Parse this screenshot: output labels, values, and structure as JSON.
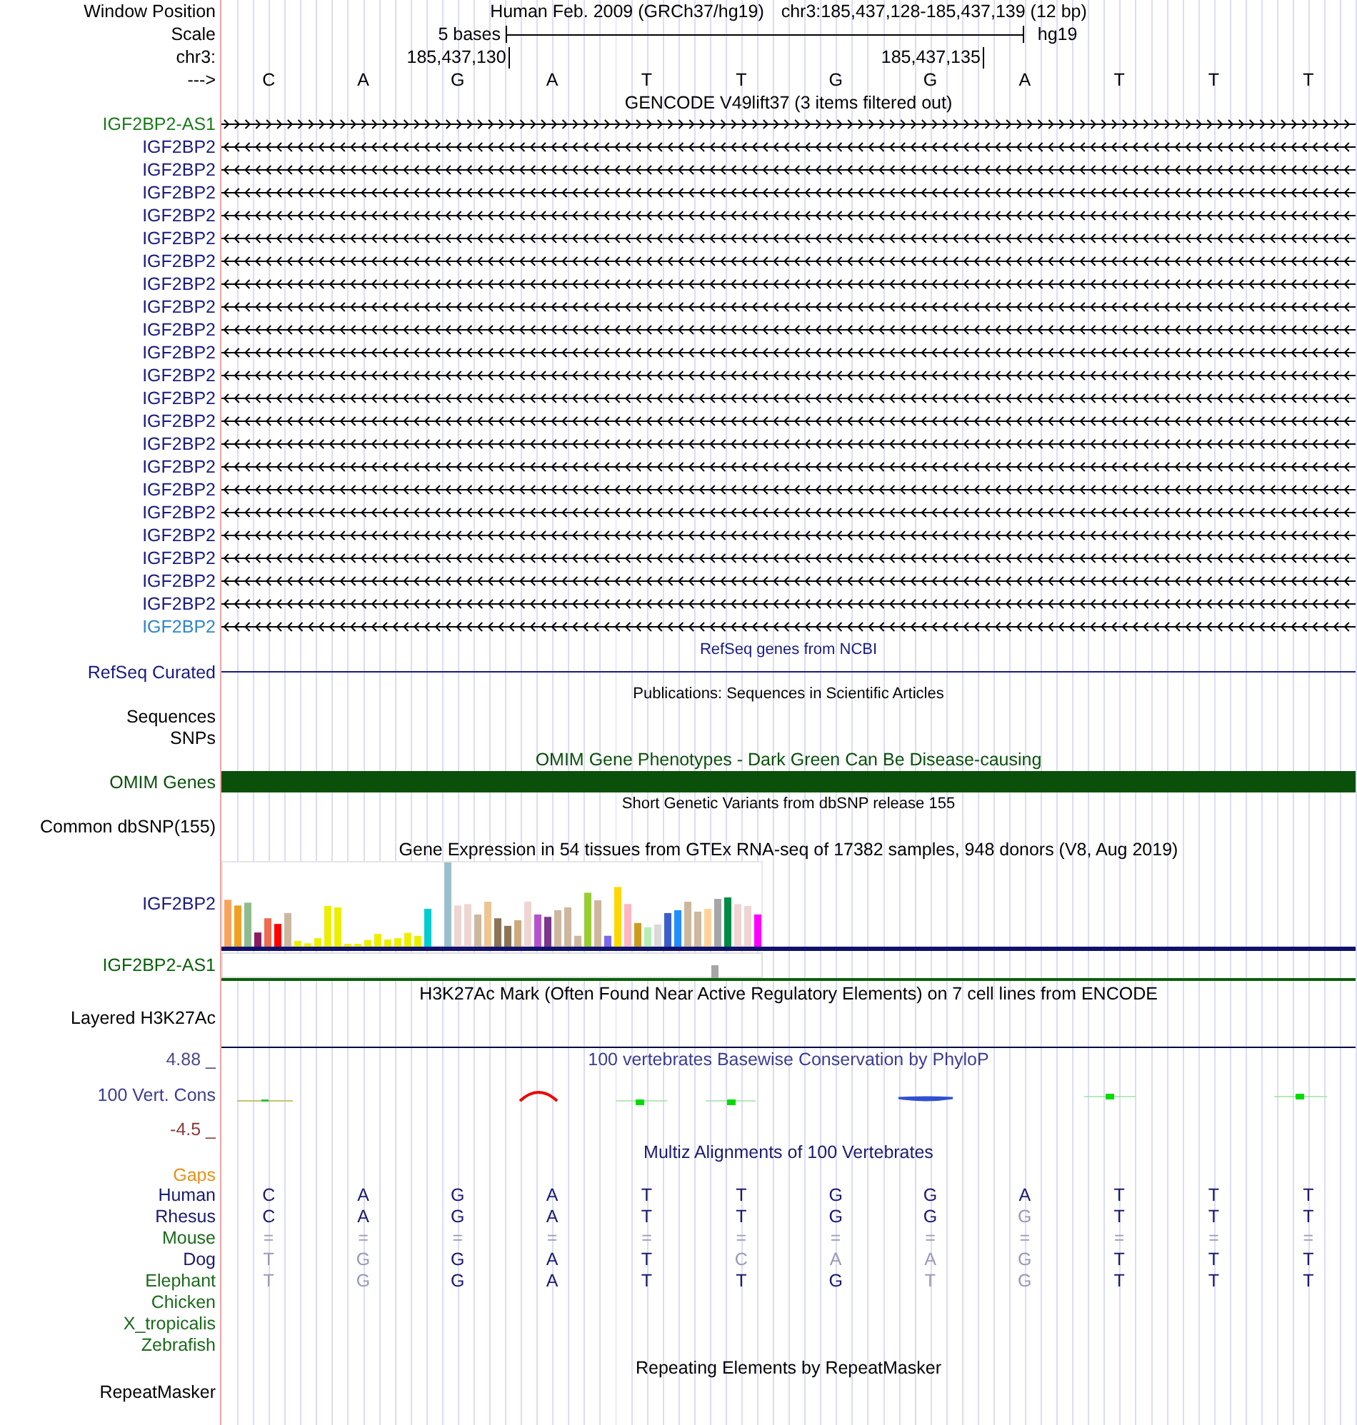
{
  "position": {
    "label": "Window Position",
    "assembly": "Human Feb. 2009 (GRCh37/hg19)",
    "range": "chr3:185,437,128-185,437,139 (12 bp)"
  },
  "scale": {
    "label": "Scale",
    "text": "5 bases",
    "db": "hg19"
  },
  "ruler": {
    "label": "chr3:"
  },
  "sequence": {
    "label": "--->",
    "bases": [
      {
        "base": "C"
      },
      {
        "base": "A"
      },
      {
        "base": "G",
        "tick": "185,437,130"
      },
      {
        "base": "A"
      },
      {
        "base": "T"
      },
      {
        "base": "T"
      },
      {
        "base": "G"
      },
      {
        "base": "G",
        "tick": "185,437,135"
      },
      {
        "base": "A"
      },
      {
        "base": "T"
      },
      {
        "base": "T"
      },
      {
        "base": "T"
      }
    ]
  },
  "tracks": [
    {
      "kind": "genes",
      "title": "GENCODE V49lift37 (3 items filtered out)",
      "color": "#000000",
      "compact": false,
      "items": [
        {
          "label": "IGF2BP2-AS1",
          "color": "#1b7a1b",
          "reverse_strand": false
        },
        {
          "label": "IGF2BP2",
          "color": "#1a1a80",
          "reverse_strand": true
        },
        {
          "label": "IGF2BP2",
          "color": "#1a1a80",
          "reverse_strand": true
        },
        {
          "label": "IGF2BP2",
          "color": "#1a1a80",
          "reverse_strand": true
        },
        {
          "label": "IGF2BP2",
          "color": "#1a1a80",
          "reverse_strand": true
        },
        {
          "label": "IGF2BP2",
          "color": "#1a1a80",
          "reverse_strand": true
        },
        {
          "label": "IGF2BP2",
          "color": "#1a1a80",
          "reverse_strand": true
        },
        {
          "label": "IGF2BP2",
          "color": "#1a1a80",
          "reverse_strand": true
        },
        {
          "label": "IGF2BP2",
          "color": "#1a1a80",
          "reverse_strand": true
        },
        {
          "label": "IGF2BP2",
          "color": "#1a1a80",
          "reverse_strand": true
        },
        {
          "label": "IGF2BP2",
          "color": "#1a1a80",
          "reverse_strand": true
        },
        {
          "label": "IGF2BP2",
          "color": "#1a1a80",
          "reverse_strand": true
        },
        {
          "label": "IGF2BP2",
          "color": "#1a1a80",
          "reverse_strand": true
        },
        {
          "label": "IGF2BP2",
          "color": "#1a1a80",
          "reverse_strand": true
        },
        {
          "label": "IGF2BP2",
          "color": "#1a1a80",
          "reverse_strand": true
        },
        {
          "label": "IGF2BP2",
          "color": "#1a1a80",
          "reverse_strand": true
        },
        {
          "label": "IGF2BP2",
          "color": "#1a1a80",
          "reverse_strand": true
        },
        {
          "label": "IGF2BP2",
          "color": "#1a1a80",
          "reverse_strand": true
        },
        {
          "label": "IGF2BP2",
          "color": "#1a1a80",
          "reverse_strand": true
        },
        {
          "label": "IGF2BP2",
          "color": "#1a1a80",
          "reverse_strand": true
        },
        {
          "label": "IGF2BP2",
          "color": "#1a1a80",
          "reverse_strand": true
        },
        {
          "label": "IGF2BP2",
          "color": "#1a1a80",
          "reverse_strand": true
        },
        {
          "label": "IGF2BP2",
          "color": "#2f86c8",
          "reverse_strand": true
        }
      ]
    },
    {
      "kind": "line",
      "title": "RefSeq genes from NCBI",
      "label": "RefSeq Curated",
      "color": "#1a1a80",
      "compact": true
    },
    {
      "kind": "empty",
      "title": "Publications: Sequences in Scientific Articles",
      "labels": [
        "Sequences",
        "SNPs"
      ],
      "color": "#000000",
      "compact": true
    },
    {
      "kind": "bar",
      "title": "OMIM Gene Phenotypes - Dark Green Can Be Disease-causing",
      "label": "OMIM Genes",
      "color": "#0a500a",
      "compact": false
    },
    {
      "kind": "empty",
      "title": "Short Genetic Variants from dbSNP release 155",
      "labels": [
        "Common dbSNP(155)"
      ],
      "color": "#000000",
      "compact": true
    },
    {
      "kind": "expression",
      "title": "Gene Expression in 54 tissues from GTEx RNA-seq of 17382 samples, 948 donors (V8, Aug 2019)",
      "color": "#000000",
      "compact": false,
      "genes": [
        {
          "label": "IGF2BP2",
          "color": "#1a1a80"
        },
        {
          "label": "IGF2BP2-AS1",
          "color": "#0a600a"
        }
      ]
    },
    {
      "kind": "empty",
      "title": "H3K27Ac Mark (Often Found Near Active Regulatory Elements) on 7 cell lines from ENCODE",
      "labels": [
        "Layered H3K27Ac"
      ],
      "color": "#000000",
      "compact": false
    },
    {
      "kind": "wiggle",
      "title": "100 vertebrates Basewise Conservation by PhyloP",
      "label": "100 Vert. Cons",
      "ymax": "4.88 _",
      "ymin": "-4.5 _",
      "color": "#3c3c90",
      "compact": false
    },
    {
      "kind": "alignment",
      "title": "Multiz Alignments of 100 Vertebrates",
      "gaps_label": "Gaps",
      "color": "#1a1a70",
      "compact": false,
      "species": [
        {
          "name": "Human",
          "color": "#1a1a70",
          "bases": [
            {
              "base": "C",
              "match": true
            },
            {
              "base": "A",
              "match": true
            },
            {
              "base": "G",
              "match": true
            },
            {
              "base": "A",
              "match": true
            },
            {
              "base": "T",
              "match": true
            },
            {
              "base": "T",
              "match": true
            },
            {
              "base": "G",
              "match": true
            },
            {
              "base": "G",
              "match": true
            },
            {
              "base": "A",
              "match": true
            },
            {
              "base": "T",
              "match": true
            },
            {
              "base": "T",
              "match": true
            },
            {
              "base": "T",
              "match": true
            }
          ]
        },
        {
          "name": "Rhesus",
          "color": "#1a1a70",
          "bases": [
            {
              "base": "C",
              "match": true
            },
            {
              "base": "A",
              "match": true
            },
            {
              "base": "G",
              "match": true
            },
            {
              "base": "A",
              "match": true
            },
            {
              "base": "T",
              "match": true
            },
            {
              "base": "T",
              "match": true
            },
            {
              "base": "G",
              "match": true
            },
            {
              "base": "G",
              "match": true
            },
            {
              "base": "G",
              "match": false
            },
            {
              "base": "T",
              "match": true
            },
            {
              "base": "T",
              "match": true
            },
            {
              "base": "T",
              "match": true
            }
          ]
        },
        {
          "name": "Mouse",
          "color": "#1b6a1b",
          "bases": [
            {
              "base": "=",
              "match": false
            },
            {
              "base": "=",
              "match": false
            },
            {
              "base": "=",
              "match": false
            },
            {
              "base": "=",
              "match": false
            },
            {
              "base": "=",
              "match": false
            },
            {
              "base": "=",
              "match": false
            },
            {
              "base": "=",
              "match": false
            },
            {
              "base": "=",
              "match": false
            },
            {
              "base": "=",
              "match": false
            },
            {
              "base": "=",
              "match": false
            },
            {
              "base": "=",
              "match": false
            },
            {
              "base": "=",
              "match": false
            }
          ]
        },
        {
          "name": "Dog",
          "color": "#1a1a70",
          "bases": [
            {
              "base": "T",
              "match": false
            },
            {
              "base": "G",
              "match": false
            },
            {
              "base": "G",
              "match": true
            },
            {
              "base": "A",
              "match": true
            },
            {
              "base": "T",
              "match": true
            },
            {
              "base": "C",
              "match": false
            },
            {
              "base": "A",
              "match": false
            },
            {
              "base": "A",
              "match": false
            },
            {
              "base": "G",
              "match": false
            },
            {
              "base": "T",
              "match": true
            },
            {
              "base": "T",
              "match": true
            },
            {
              "base": "T",
              "match": true
            }
          ]
        },
        {
          "name": "Elephant",
          "color": "#1b6a1b",
          "bases": [
            {
              "base": "T",
              "match": false
            },
            {
              "base": "G",
              "match": false
            },
            {
              "base": "G",
              "match": true
            },
            {
              "base": "A",
              "match": true
            },
            {
              "base": "T",
              "match": true
            },
            {
              "base": "T",
              "match": true
            },
            {
              "base": "G",
              "match": true
            },
            {
              "base": "T",
              "match": false
            },
            {
              "base": "G",
              "match": false
            },
            {
              "base": "T",
              "match": true
            },
            {
              "base": "T",
              "match": true
            },
            {
              "base": "T",
              "match": true
            }
          ]
        },
        {
          "name": "Chicken",
          "color": "#1b6a1b"
        },
        {
          "name": "X_tropicalis",
          "color": "#1b6a1b"
        },
        {
          "name": "Zebrafish",
          "color": "#1b6a1b"
        }
      ]
    },
    {
      "kind": "empty",
      "title": "Repeating Elements by RepeatMasker",
      "labels": [
        "RepeatMasker"
      ],
      "color": "#000000",
      "compact": false
    }
  ]
}
